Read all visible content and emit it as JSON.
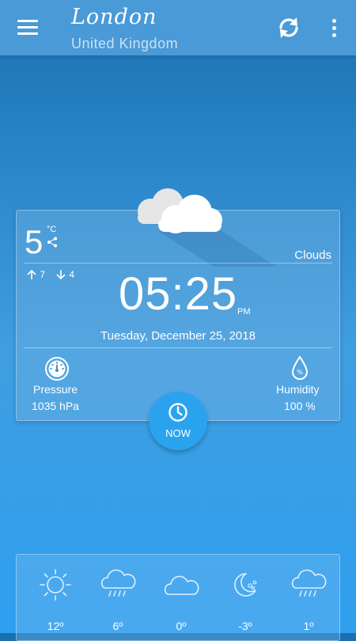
{
  "header": {
    "city": "London",
    "country": "United Kingdom",
    "icons": [
      "menu-icon",
      "refresh-icon",
      "more-vert-icon"
    ]
  },
  "current": {
    "temperature": "5",
    "unit": "°C",
    "condition": "Clouds",
    "high": "7",
    "low": "4",
    "time": "05:25",
    "ampm": "PM",
    "date": "Tuesday, December 25, 2018",
    "pressure_label": "Pressure",
    "pressure_value": "1035 hPa",
    "humidity_label": "Humidity",
    "humidity_value": "100 %",
    "icon": "clouds-icon"
  },
  "now_button": {
    "label": "NOW",
    "icon": "clock-icon"
  },
  "forecast": [
    {
      "icon": "sun-icon",
      "temp": "12º"
    },
    {
      "icon": "rain-cloud-icon",
      "temp": "6º"
    },
    {
      "icon": "cloud-icon",
      "temp": "0º"
    },
    {
      "icon": "moon-snow-icon",
      "temp": "-3º"
    },
    {
      "icon": "rain-cloud-icon",
      "temp": "1º"
    }
  ],
  "colors": {
    "appbar": "#4a9ad8",
    "background_top": "#1a6fb0",
    "background_bottom": "#2f9ff0",
    "accent": "#2aa3ef"
  }
}
